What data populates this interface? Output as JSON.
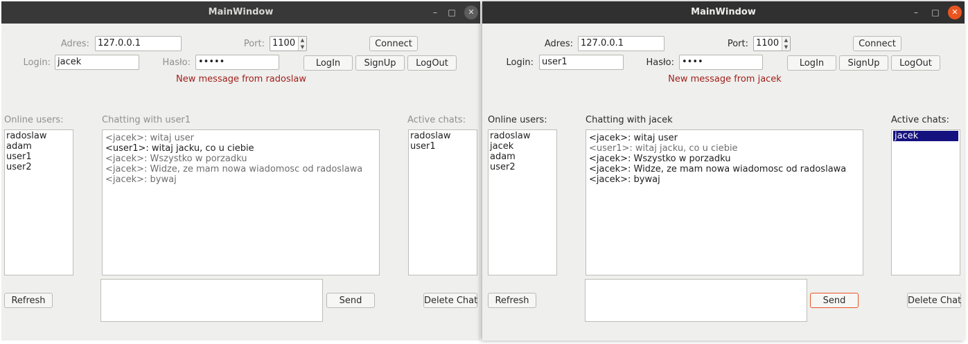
{
  "windows": [
    {
      "title": "MainWindow",
      "window_controls": {
        "minimize": "–",
        "maximize": "□",
        "close": "✕"
      },
      "labels": {
        "address": "Adres:",
        "port": "Port:",
        "login": "Login:",
        "password": "Hasło:"
      },
      "fields": {
        "address": "127.0.0.1",
        "port": "1100",
        "login": "jacek",
        "password": "•••••"
      },
      "buttons": {
        "connect": "Connect",
        "login": "LogIn",
        "signup": "SignUp",
        "logout": "LogOut",
        "refresh": "Refresh",
        "send": "Send",
        "delete_chat": "Delete Chat"
      },
      "notification": "New message from radoslaw",
      "online_users_label": "Online users:",
      "chatting_label": "Chatting with user1",
      "active_chats_label": "Active chats:",
      "online_users": [
        "radoslaw",
        "adam",
        "user1",
        "user2"
      ],
      "messages": [
        "<jacek>: witaj user",
        "<user1>:  witaj jacku, co u ciebie",
        "<jacek>: Wszystko w porzadku",
        "<jacek>: Widze, ze mam nowa wiadomosc od radoslawa",
        "<jacek>: bywaj"
      ],
      "active_chats": [
        "radoslaw",
        "user1"
      ]
    },
    {
      "title": "MainWindow",
      "window_controls": {
        "minimize": "–",
        "maximize": "□",
        "close": "✕"
      },
      "labels": {
        "address": "Adres:",
        "port": "Port:",
        "login": "Login:",
        "password": "Hasło:"
      },
      "fields": {
        "address": "127.0.0.1",
        "port": "1100",
        "login": "user1",
        "password": "••••"
      },
      "buttons": {
        "connect": "Connect",
        "login": "LogIn",
        "signup": "SignUp",
        "logout": "LogOut",
        "refresh": "Refresh",
        "send": "Send",
        "delete_chat": "Delete Chat"
      },
      "notification": "New message from jacek",
      "online_users_label": "Online users:",
      "chatting_label": "Chatting with jacek",
      "active_chats_label": "Active chats:",
      "online_users": [
        "radoslaw",
        "jacek",
        "adam",
        "user2"
      ],
      "messages": [
        "<jacek>:  witaj user",
        "<user1>: witaj jacku, co u ciebie",
        "<jacek>:  Wszystko w porzadku",
        "<jacek>:  Widze, ze mam nowa wiadomosc od radoslawa",
        "<jacek>:  bywaj"
      ],
      "active_chats": [
        "jacek"
      ],
      "selected_active_chat": "jacek"
    }
  ],
  "colors": {
    "notification": "#a01f1a",
    "selection": "#15127f",
    "close_button_active": "#e95420",
    "titlebar": "#303030"
  }
}
